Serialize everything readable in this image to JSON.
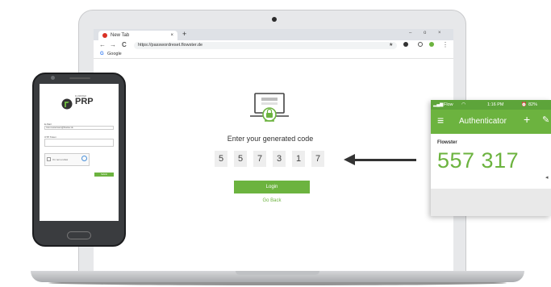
{
  "browser": {
    "tab_title": "New Tab",
    "new_tab_symbol": "+",
    "tab_close": "×",
    "url": "https://passwordreset.flowster.de",
    "bookmark": "Google",
    "nav": {
      "back": "←",
      "forward": "→",
      "reload": "C"
    },
    "window_controls": {
      "minimize": "–",
      "maximize": "o",
      "close": "×"
    },
    "menu_symbol": "⋮"
  },
  "page": {
    "prompt": "Enter your generated code",
    "code_digits": [
      "5",
      "5",
      "7",
      "3",
      "1",
      "7"
    ],
    "login_label": "Login",
    "go_back_label": "Go Back"
  },
  "authenticator": {
    "carrier": "Flow",
    "time": "1:16 PM",
    "battery": "82%",
    "title": "Authenticator",
    "menu_symbol": "≡",
    "add_symbol": "+",
    "edit_symbol": "✎",
    "issuer": "Flowster",
    "code": "557 317"
  },
  "phone": {
    "logo_text": "PRP",
    "logo_small": "FLOWSTER",
    "field1_label": "E-Mail",
    "field1_value": "max.mustermann@flowster.de",
    "field2_label": "OTP Token",
    "captcha_label": "I'm not a robot",
    "submit_label": "Submit"
  },
  "colors": {
    "accent": "#6cb33f",
    "accent_dark": "#5da43a"
  }
}
